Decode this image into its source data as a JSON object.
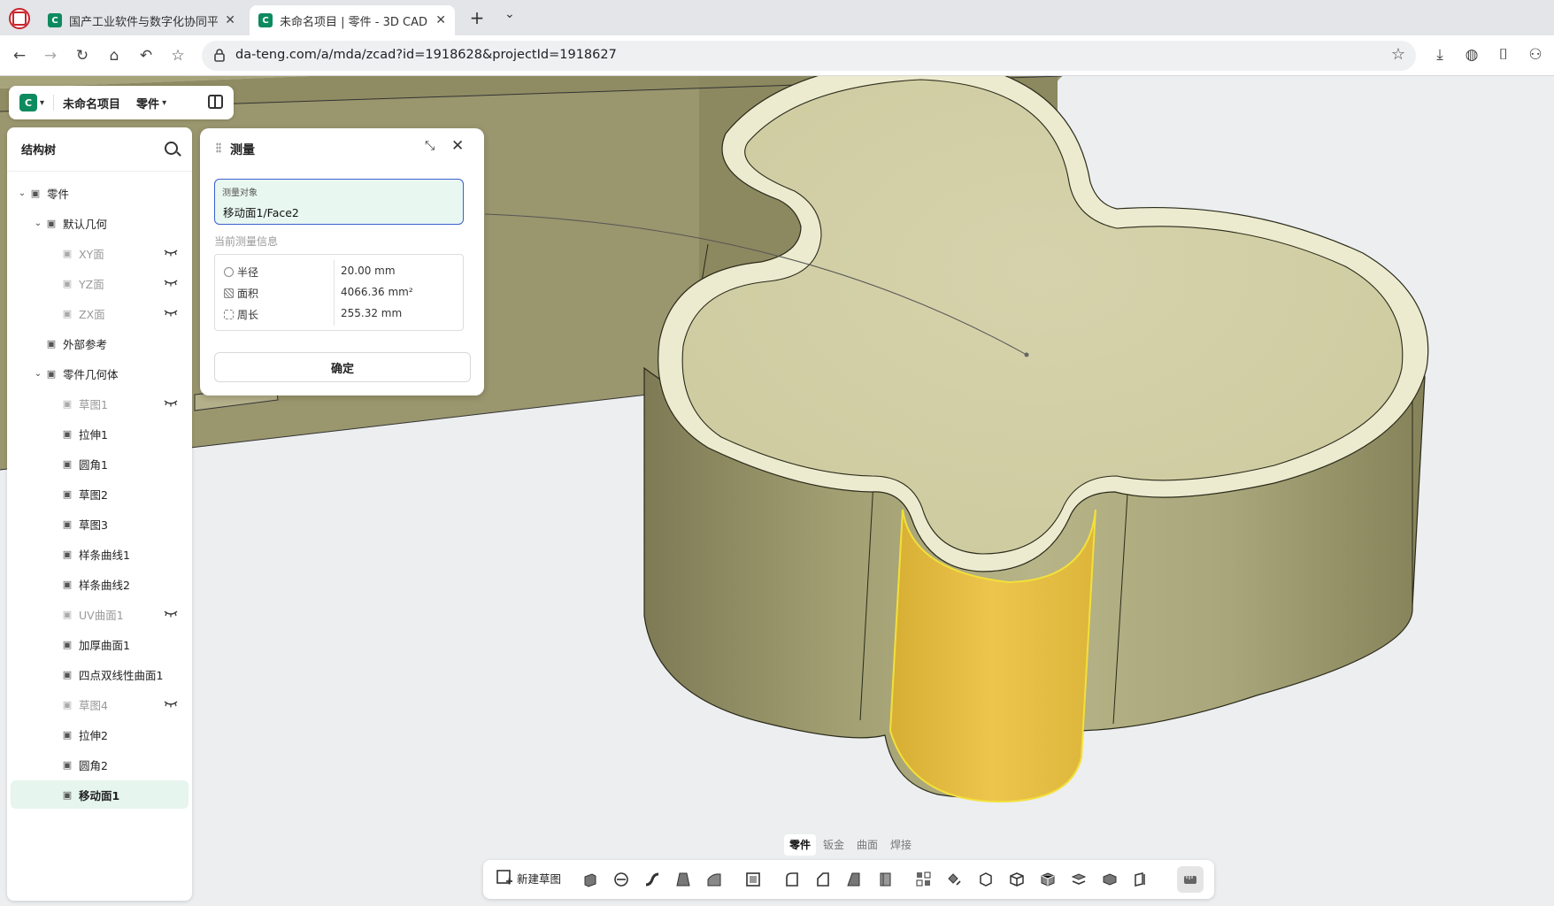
{
  "browser": {
    "tabs": [
      {
        "title": "国产工业软件与数字化协同平",
        "favicon": "C",
        "active": false
      },
      {
        "title": "未命名项目 | 零件 - 3D CAD",
        "favicon": "C",
        "active": true
      }
    ],
    "new_tab_symbol": "+",
    "tab_menu_symbol": "⌄",
    "url": "da-teng.com/a/mda/zcad?id=1918628&projectId=1918627"
  },
  "projbar": {
    "logo": "C",
    "project_name": "未命名项目",
    "mode": "零件"
  },
  "tree": {
    "title": "结构树",
    "items": [
      {
        "label": "零件",
        "level": 0,
        "chev": true,
        "icon": "part-icon",
        "muted": false,
        "eye": false
      },
      {
        "label": "默认几何",
        "level": 1,
        "chev": true,
        "icon": "geometry-icon",
        "muted": false,
        "eye": false
      },
      {
        "label": "XY面",
        "level": 2,
        "chev": false,
        "icon": "plane-icon",
        "muted": true,
        "eye": true
      },
      {
        "label": "YZ面",
        "level": 2,
        "chev": false,
        "icon": "plane-icon",
        "muted": true,
        "eye": true
      },
      {
        "label": "ZX面",
        "level": 2,
        "chev": false,
        "icon": "plane-icon",
        "muted": true,
        "eye": true
      },
      {
        "label": "外部参考",
        "level": 1,
        "chev": false,
        "icon": "reference-icon",
        "muted": false,
        "eye": false
      },
      {
        "label": "零件几何体",
        "level": 1,
        "chev": true,
        "icon": "body-icon",
        "muted": false,
        "eye": false
      },
      {
        "label": "草图1",
        "level": 2,
        "chev": false,
        "icon": "sketch-icon",
        "muted": true,
        "eye": true
      },
      {
        "label": "拉伸1",
        "level": 2,
        "chev": false,
        "icon": "extrude-icon",
        "muted": false,
        "eye": false
      },
      {
        "label": "圆角1",
        "level": 2,
        "chev": false,
        "icon": "fillet-icon",
        "muted": false,
        "eye": false
      },
      {
        "label": "草图2",
        "level": 2,
        "chev": false,
        "icon": "sketch-icon",
        "muted": false,
        "eye": false
      },
      {
        "label": "草图3",
        "level": 2,
        "chev": false,
        "icon": "sketch-icon",
        "muted": false,
        "eye": false
      },
      {
        "label": "样条曲线1",
        "level": 2,
        "chev": false,
        "icon": "spline-icon",
        "muted": false,
        "eye": false
      },
      {
        "label": "样条曲线2",
        "level": 2,
        "chev": false,
        "icon": "spline-icon",
        "muted": false,
        "eye": false
      },
      {
        "label": "UV曲面1",
        "level": 2,
        "chev": false,
        "icon": "surface-icon",
        "muted": true,
        "eye": true
      },
      {
        "label": "加厚曲面1",
        "level": 2,
        "chev": false,
        "icon": "thicken-icon",
        "muted": false,
        "eye": false
      },
      {
        "label": "四点双线性曲面1",
        "level": 2,
        "chev": false,
        "icon": "bilinear-surface-icon",
        "muted": false,
        "eye": false
      },
      {
        "label": "草图4",
        "level": 2,
        "chev": false,
        "icon": "sketch-icon",
        "muted": true,
        "eye": true
      },
      {
        "label": "拉伸2",
        "level": 2,
        "chev": false,
        "icon": "extrude-icon",
        "muted": false,
        "eye": false
      },
      {
        "label": "圆角2",
        "level": 2,
        "chev": false,
        "icon": "fillet-icon",
        "muted": false,
        "eye": false
      },
      {
        "label": "移动面1",
        "level": 2,
        "chev": false,
        "icon": "move-face-icon",
        "muted": false,
        "eye": false,
        "selected": true
      }
    ]
  },
  "measure": {
    "title": "测量",
    "target_label": "测量对象",
    "target_value": "移动面1/Face2",
    "info_label": "当前测量信息",
    "rows": [
      {
        "key": "半径",
        "value": "20.00 mm",
        "icon": "radius-icon"
      },
      {
        "key": "面积",
        "value": "4066.36 mm²",
        "icon": "area-icon"
      },
      {
        "key": "周长",
        "value": "255.32 mm",
        "icon": "perimeter-icon"
      }
    ],
    "confirm": "确定"
  },
  "bottom": {
    "modes": [
      {
        "label": "零件",
        "active": true
      },
      {
        "label": "钣金",
        "active": false
      },
      {
        "label": "曲面",
        "active": false
      },
      {
        "label": "焊接",
        "active": false
      }
    ],
    "new_sketch": "新建草图"
  },
  "colors": {
    "model": "#c9c595",
    "highlight": "#e8c24a",
    "accent": "#0e8a5f"
  }
}
